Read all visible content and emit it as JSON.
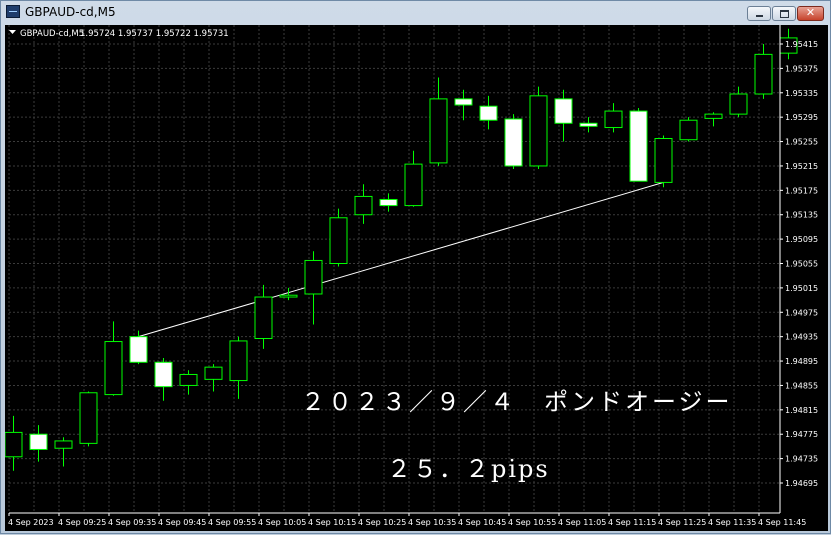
{
  "window": {
    "title": "GBPAUD-cd,M5",
    "close_label": "✕"
  },
  "chart_info": {
    "symbol": "GBPAUD-cd,M5",
    "ohlc": "1.95724 1.95737 1.95722 1.95731"
  },
  "overlay": {
    "line1": "２０２３／９／４　ポンドオージー",
    "line2": "２５．２pips"
  },
  "colors": {
    "background": "#000000",
    "grid": "#3b3b3b",
    "candle_up_body": "#000000",
    "candle_down_body": "#ffffff",
    "candle_outline": "#00ff00",
    "trendline": "#ffffff",
    "axis_text": "#ffffff"
  },
  "chart_data": {
    "type": "candlestick",
    "title": "GBPAUD-cd,M5",
    "ylim": [
      1.9469,
      1.95455
    ],
    "y_ticks": [
      1.95415,
      1.95375,
      1.95335,
      1.95295,
      1.95255,
      1.95215,
      1.95175,
      1.95135,
      1.95095,
      1.95055,
      1.95015,
      1.94975,
      1.94935,
      1.94895,
      1.94855,
      1.94815,
      1.94775,
      1.94735,
      1.94695
    ],
    "y_tick_labels": [
      "1.95415",
      "1.95375",
      "1.95335",
      "1.95295",
      "1.95255",
      "1.95215",
      "1.95175",
      "1.95135",
      "1.95095",
      "1.95055",
      "1.95015",
      "1.94975",
      "1.94935",
      "1.94895",
      "1.94855",
      "1.94815",
      "1.94775",
      "1.94735",
      "1.94695"
    ],
    "x_tick_labels": [
      "4 Sep 2023",
      "4 Sep 09:25",
      "4 Sep 09:35",
      "4 Sep 09:45",
      "4 Sep 09:55",
      "4 Sep 10:05",
      "4 Sep 10:15",
      "4 Sep 10:25",
      "4 Sep 10:35",
      "4 Sep 10:45",
      "4 Sep 10:55",
      "4 Sep 11:05",
      "4 Sep 11:15",
      "4 Sep 11:25",
      "4 Sep 11:35",
      "4 Sep 11:45"
    ],
    "candles": [
      {
        "o": 1.94738,
        "h": 1.94805,
        "l": 1.94715,
        "c": 1.94778
      },
      {
        "o": 1.94775,
        "h": 1.9479,
        "l": 1.9473,
        "c": 1.9475
      },
      {
        "o": 1.94752,
        "h": 1.9477,
        "l": 1.94722,
        "c": 1.94764
      },
      {
        "o": 1.9476,
        "h": 1.94845,
        "l": 1.94755,
        "c": 1.94843
      },
      {
        "o": 1.9484,
        "h": 1.9496,
        "l": 1.94838,
        "c": 1.94927
      },
      {
        "o": 1.94935,
        "h": 1.94945,
        "l": 1.9489,
        "c": 1.94893
      },
      {
        "o": 1.94893,
        "h": 1.949,
        "l": 1.9483,
        "c": 1.94853
      },
      {
        "o": 1.94855,
        "h": 1.9488,
        "l": 1.9484,
        "c": 1.94873
      },
      {
        "o": 1.94865,
        "h": 1.9489,
        "l": 1.94845,
        "c": 1.94885
      },
      {
        "o": 1.94863,
        "h": 1.94935,
        "l": 1.94833,
        "c": 1.94928
      },
      {
        "o": 1.94932,
        "h": 1.9502,
        "l": 1.94915,
        "c": 1.95
      },
      {
        "o": 1.95,
        "h": 1.95015,
        "l": 1.94995,
        "c": 1.95003
      },
      {
        "o": 1.95005,
        "h": 1.95075,
        "l": 1.94955,
        "c": 1.9506
      },
      {
        "o": 1.95055,
        "h": 1.95145,
        "l": 1.9505,
        "c": 1.9513
      },
      {
        "o": 1.95135,
        "h": 1.95185,
        "l": 1.9512,
        "c": 1.95165
      },
      {
        "o": 1.9516,
        "h": 1.9517,
        "l": 1.9514,
        "c": 1.9515
      },
      {
        "o": 1.9515,
        "h": 1.9524,
        "l": 1.95148,
        "c": 1.95218
      },
      {
        "o": 1.9522,
        "h": 1.9536,
        "l": 1.95215,
        "c": 1.95325
      },
      {
        "o": 1.95325,
        "h": 1.9534,
        "l": 1.9529,
        "c": 1.95315
      },
      {
        "o": 1.95313,
        "h": 1.9533,
        "l": 1.95275,
        "c": 1.9529
      },
      {
        "o": 1.95292,
        "h": 1.953,
        "l": 1.9521,
        "c": 1.95215
      },
      {
        "o": 1.95215,
        "h": 1.95345,
        "l": 1.9521,
        "c": 1.9533
      },
      {
        "o": 1.95325,
        "h": 1.9534,
        "l": 1.95255,
        "c": 1.95285
      },
      {
        "o": 1.95285,
        "h": 1.95295,
        "l": 1.9527,
        "c": 1.9528
      },
      {
        "o": 1.95278,
        "h": 1.95318,
        "l": 1.9527,
        "c": 1.95305
      },
      {
        "o": 1.95305,
        "h": 1.9531,
        "l": 1.9519,
        "c": 1.9519
      },
      {
        "o": 1.95188,
        "h": 1.95265,
        "l": 1.9518,
        "c": 1.9526
      },
      {
        "o": 1.95258,
        "h": 1.95295,
        "l": 1.95255,
        "c": 1.9529
      },
      {
        "o": 1.95293,
        "h": 1.95303,
        "l": 1.9528,
        "c": 1.953
      },
      {
        "o": 1.953,
        "h": 1.95345,
        "l": 1.95295,
        "c": 1.95333
      },
      {
        "o": 1.95333,
        "h": 1.95415,
        "l": 1.95325,
        "c": 1.95398
      },
      {
        "o": 1.954,
        "h": 1.9544,
        "l": 1.9539,
        "c": 1.95425
      }
    ],
    "trendline": {
      "from": {
        "candle": 5,
        "price": 1.94935
      },
      "to": {
        "candle": 26,
        "price": 1.95188
      }
    }
  }
}
